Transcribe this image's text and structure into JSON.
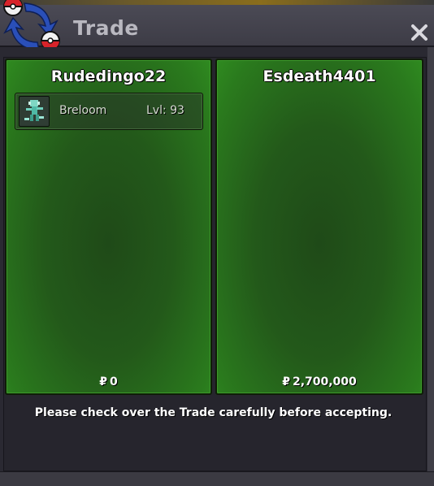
{
  "window": {
    "title": "Trade",
    "close_icon": "close-icon",
    "logo_icon": "pokeball-trade-logo-icon"
  },
  "trade": {
    "left": {
      "player": "Rudedingo22",
      "pokemon": [
        {
          "name": "Breloom",
          "level_label": "Lvl: 93",
          "sprite_icon": "breloom-sprite-icon"
        }
      ],
      "currency_symbol": "₽",
      "money": "0"
    },
    "right": {
      "player": "Esdeath4401",
      "pokemon": [],
      "currency_symbol": "₽",
      "money": "2,700,000"
    }
  },
  "notice": "Please check over the Trade carefully before accepting.",
  "colors": {
    "panel_green": "#2a7a1d",
    "panel_dark_green": "#1f4a18",
    "frame": "#25242c",
    "title_text": "#b9b8c0"
  }
}
